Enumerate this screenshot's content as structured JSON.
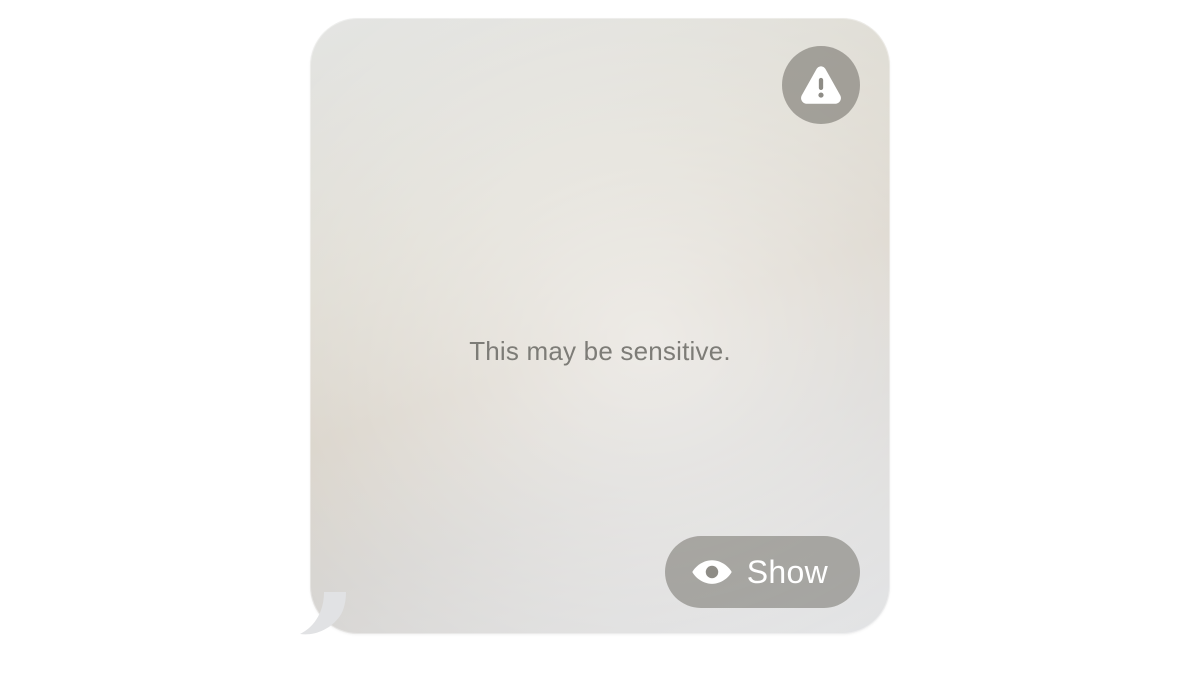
{
  "bubble": {
    "message": "This may be sensitive.",
    "show_label": "Show",
    "icons": {
      "warning": "warning-triangle-icon",
      "eye": "eye-icon"
    }
  },
  "colors": {
    "overlay_pill": "#7a7871",
    "text_muted": "#7d7c77",
    "pill_text": "#ffffff"
  }
}
